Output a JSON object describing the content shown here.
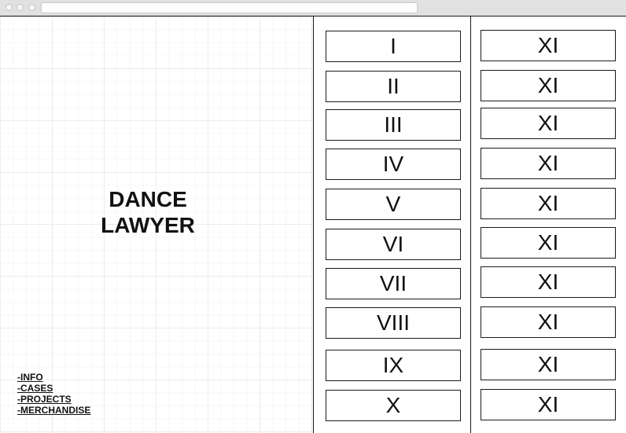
{
  "site": {
    "title_line1": "DANCE",
    "title_line2": "LAWYER"
  },
  "nav": [
    {
      "label": "-INFO"
    },
    {
      "label": "-CASES"
    },
    {
      "label": "-PROJECTS"
    },
    {
      "label": "-MERCHANDISE"
    }
  ],
  "tiles_left": [
    {
      "label": "I"
    },
    {
      "label": "II"
    },
    {
      "label": "III"
    },
    {
      "label": "IV"
    },
    {
      "label": "V"
    },
    {
      "label": "VI"
    },
    {
      "label": "VII"
    },
    {
      "label": "VIII"
    },
    {
      "label": "IX"
    },
    {
      "label": "X"
    }
  ],
  "tiles_right": [
    {
      "label": "XI"
    },
    {
      "label": "XI"
    },
    {
      "label": "XI"
    },
    {
      "label": "XI"
    },
    {
      "label": "XI"
    },
    {
      "label": "XI"
    },
    {
      "label": "XI"
    },
    {
      "label": "XI"
    },
    {
      "label": "XI"
    },
    {
      "label": "XI"
    }
  ]
}
